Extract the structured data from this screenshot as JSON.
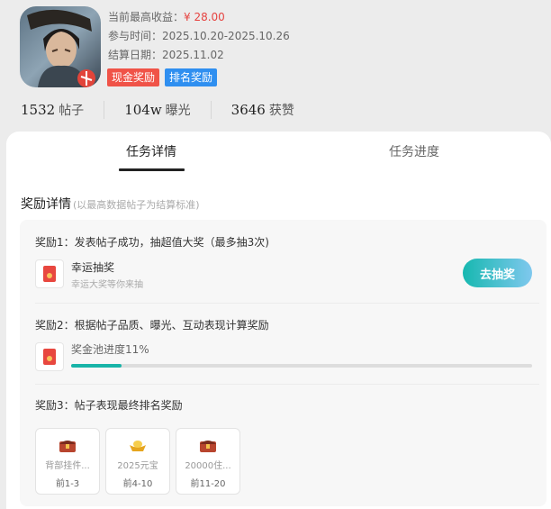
{
  "header": {
    "game_icon": "game-character-icon",
    "max_income_label": "当前最高收益：",
    "max_income_value": "¥ 28.00",
    "participate_label": "参与时间：",
    "participate_value": "2025.10.20-2025.10.26",
    "settle_label": "结算日期：",
    "settle_value": "2025.11.02",
    "tags": [
      "现金奖励",
      "排名奖励"
    ],
    "accent_red": "#f05348",
    "accent_blue": "#2f8ff0"
  },
  "stats": [
    {
      "num": "1532",
      "label": "帖子"
    },
    {
      "num": "104w",
      "label": "曝光"
    },
    {
      "num": "3646",
      "label": "获赞"
    }
  ],
  "tabs": {
    "active": "任务详情",
    "inactive": "任务进度"
  },
  "section": {
    "title": "奖励详情",
    "hint": "(以最高数据帖子为结算标准)"
  },
  "rewards": {
    "r1_title": "奖励1：发表帖子成功，抽超值大奖（最多抽3次)",
    "lucky_name": "幸运抽奖",
    "lucky_sub": "幸运大奖等你来抽",
    "draw_button": "去抽奖",
    "r2_title": "奖励2：根据帖子品质、曝光、互动表现计算奖励",
    "pool_progress_label": "奖金池进度11%",
    "pool_progress": 0.11,
    "r3_title": "奖励3：帖子表现最终排名奖励",
    "prizes": [
      {
        "name": "背部挂件...",
        "rank": "前1-3",
        "icon": "treasure-chest-icon"
      },
      {
        "name": "2025元宝",
        "rank": "前4-10",
        "icon": "gold-ingot-icon"
      },
      {
        "name": "20000住...",
        "rank": "前11-20",
        "icon": "treasure-chest-icon"
      }
    ]
  }
}
